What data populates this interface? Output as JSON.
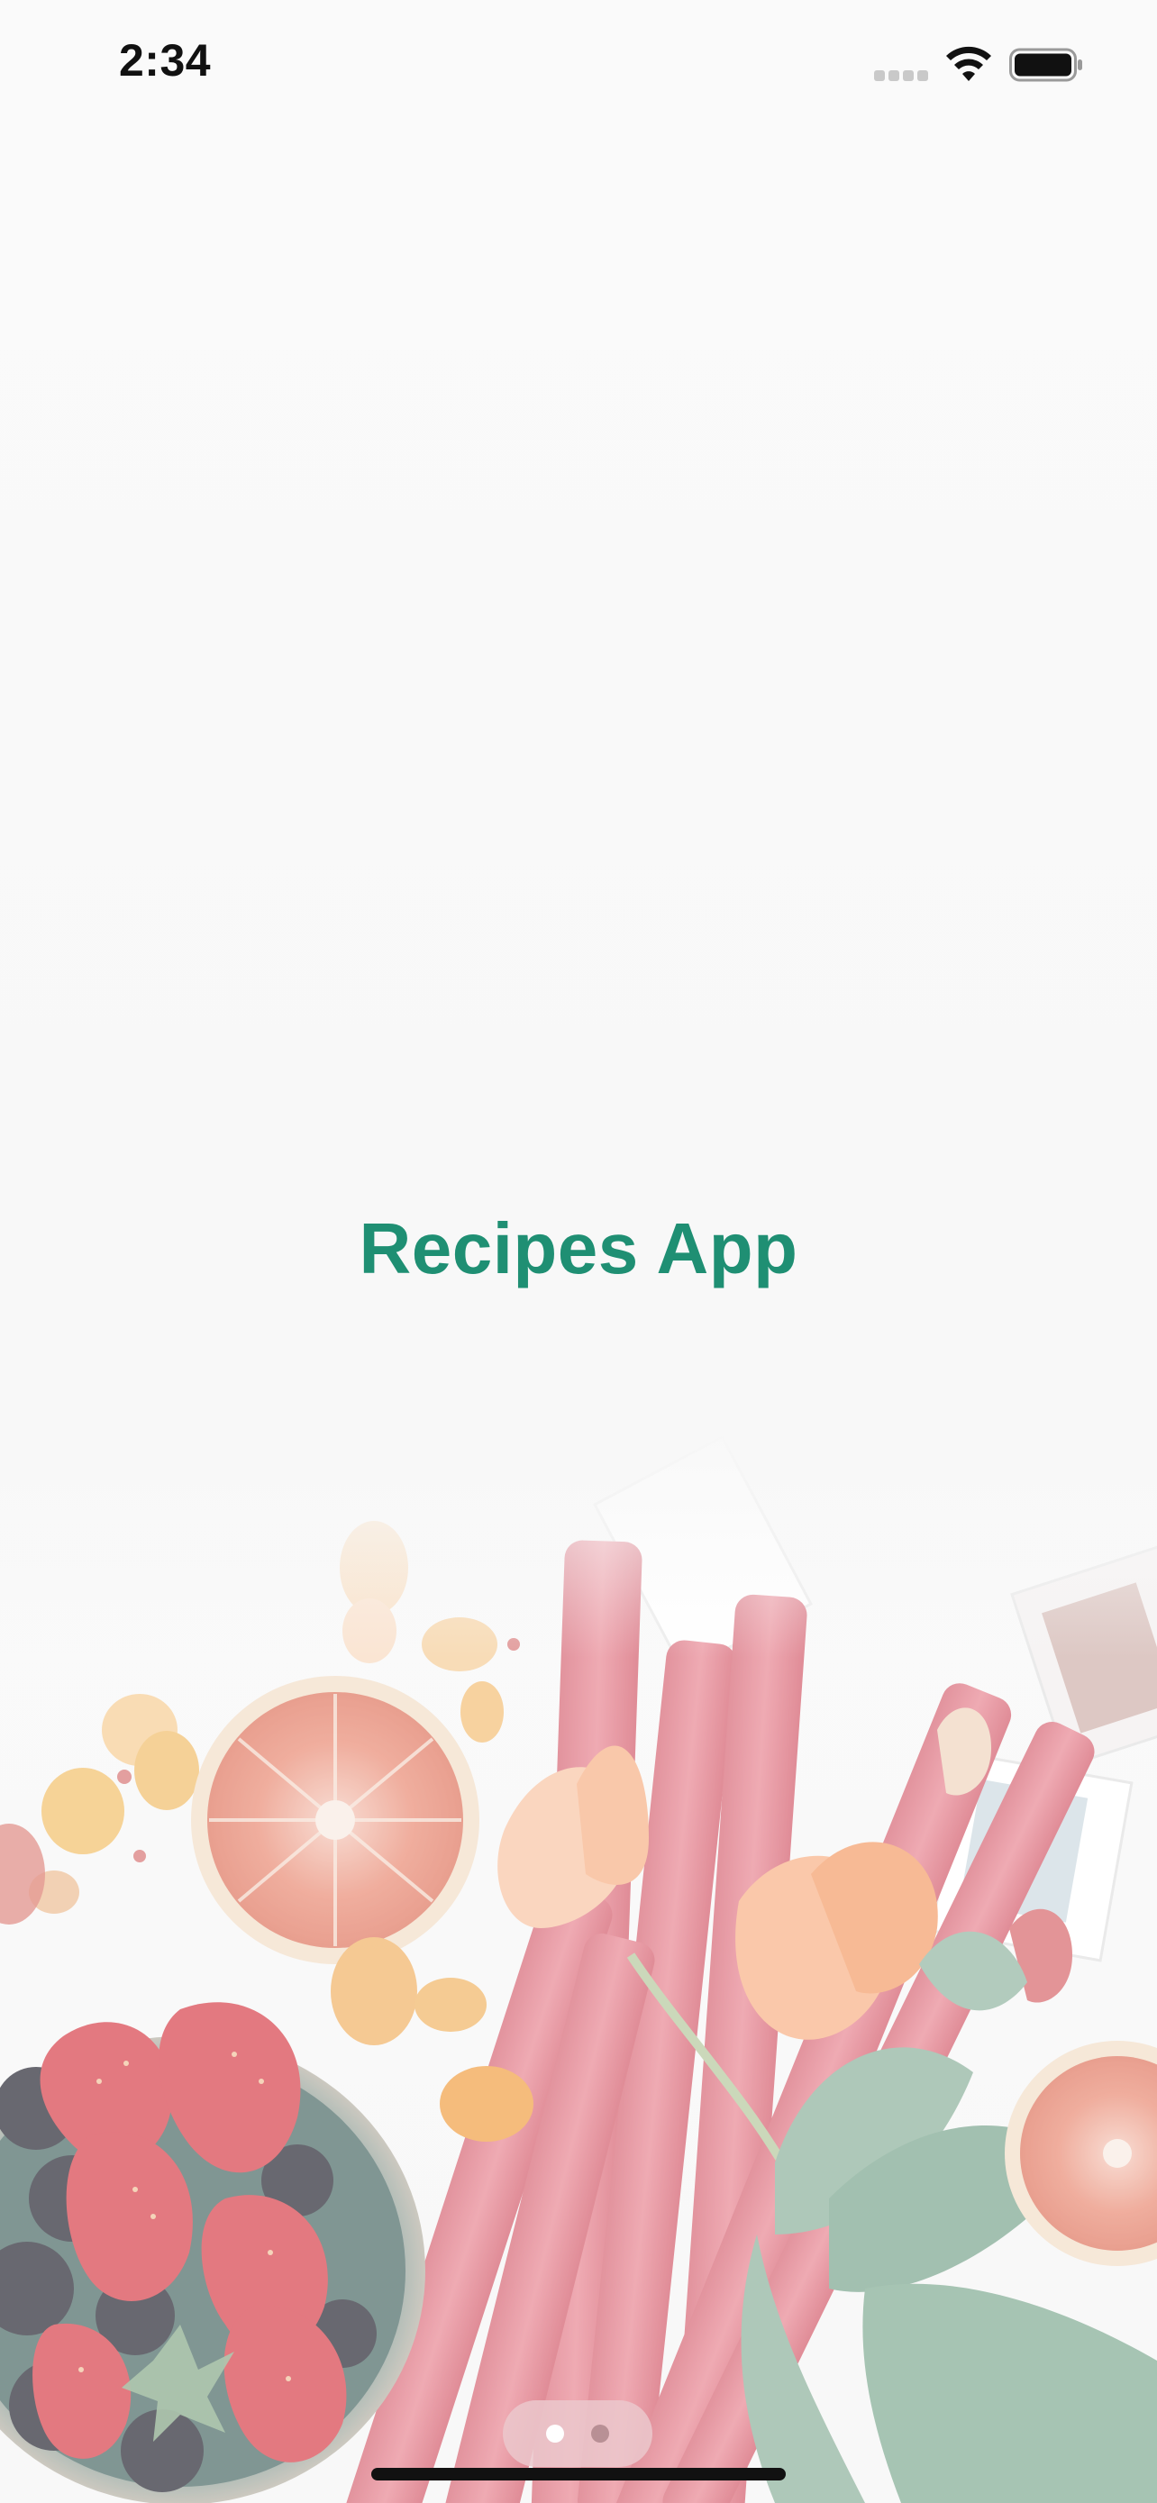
{
  "status_bar": {
    "time": "2:34",
    "icons": [
      "cellular-signal-icon",
      "wifi-icon",
      "battery-icon"
    ]
  },
  "splash": {
    "title": "Recipes App",
    "title_color": "#1f8f73",
    "background_image": "food-flatlay-illustration"
  },
  "page_indicator": {
    "pages": 2,
    "current": 1
  }
}
